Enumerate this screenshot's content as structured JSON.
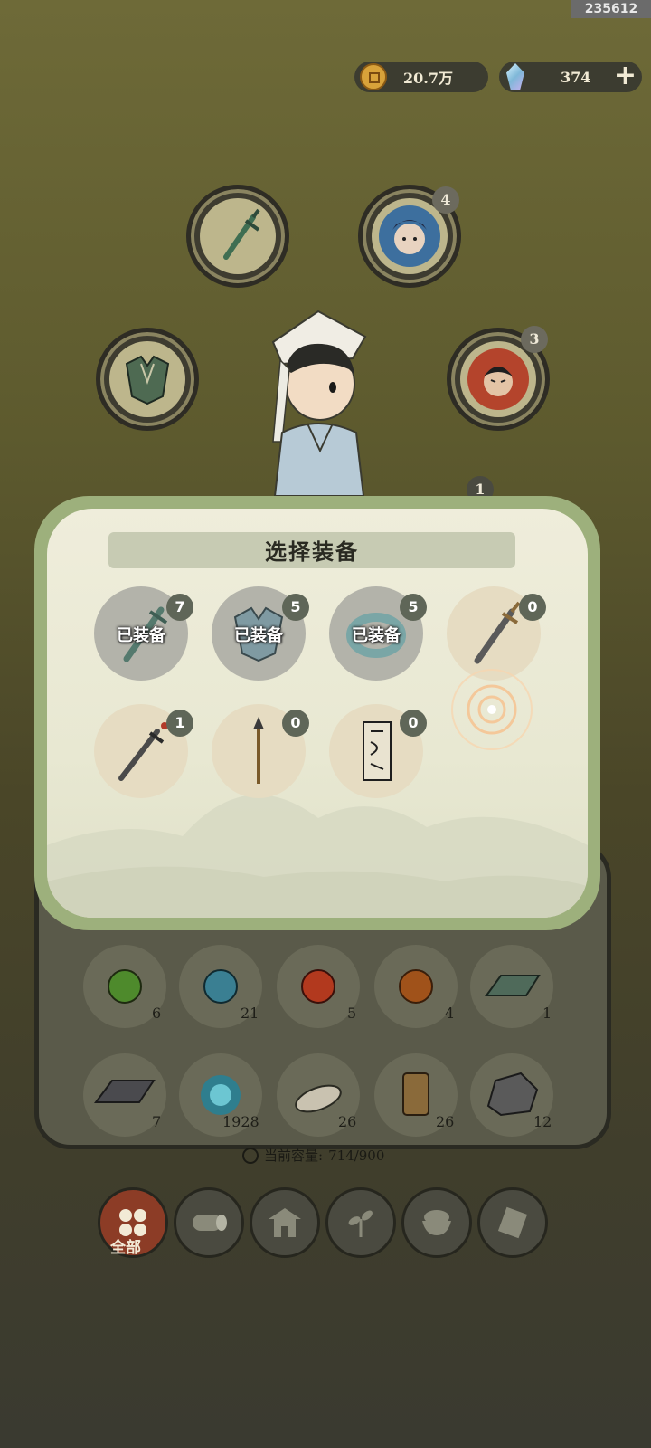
{
  "corner_id": "235612",
  "currency": {
    "coins": "20.7万",
    "gems": "374",
    "add_symbol": "+"
  },
  "equip_slots": [
    {
      "name": "weapon",
      "badge": ""
    },
    {
      "name": "companion-blue",
      "badge": "4"
    },
    {
      "name": "armor",
      "badge": ""
    },
    {
      "name": "companion-red",
      "badge": "3"
    },
    {
      "name": "partially-hidden-slot",
      "badge": "1"
    }
  ],
  "modal": {
    "title": "选择装备",
    "items": [
      {
        "name": "jade-sword",
        "count": "7",
        "equipped": true,
        "equipped_label": "已装备"
      },
      {
        "name": "leaf-armor",
        "count": "5",
        "equipped": true,
        "equipped_label": "已装备"
      },
      {
        "name": "jade-bracelet",
        "count": "5",
        "equipped": true,
        "equipped_label": "已装备"
      },
      {
        "name": "iron-sword",
        "count": "0",
        "equipped": false,
        "equipped_label": ""
      },
      {
        "name": "steel-sword",
        "count": "1",
        "equipped": false,
        "equipped_label": ""
      },
      {
        "name": "spear",
        "count": "0",
        "equipped": false,
        "equipped_label": ""
      },
      {
        "name": "talisman-scroll",
        "count": "0",
        "equipped": false,
        "equipped_label": ""
      }
    ]
  },
  "materials": [
    {
      "name": "green-orb",
      "count": "6",
      "color": "#4e8a2c"
    },
    {
      "name": "blue-orb",
      "count": "21",
      "color": "#3a7f92"
    },
    {
      "name": "red-orb",
      "count": "5",
      "color": "#b2391e"
    },
    {
      "name": "amber-orb",
      "count": "4",
      "color": "#a0521a"
    },
    {
      "name": "green-ingot",
      "count": "1",
      "color": "#4f6a5a"
    },
    {
      "name": "iron-ingot",
      "count": "7",
      "color": "#4a4a4e"
    },
    {
      "name": "spirit-flame",
      "count": "1928",
      "color": "#2f7e8e"
    },
    {
      "name": "bone",
      "count": "26",
      "color": "#c9c2b0"
    },
    {
      "name": "lantern-token",
      "count": "26",
      "color": "#8a6a3a"
    },
    {
      "name": "ore",
      "count": "12",
      "color": "#5a5a5a"
    }
  ],
  "capacity": {
    "label": "当前容量:",
    "value": "714/900"
  },
  "tabs": [
    {
      "name": "all",
      "label": "全部",
      "active": true
    },
    {
      "name": "wood",
      "label": "",
      "active": false
    },
    {
      "name": "building",
      "label": "",
      "active": false
    },
    {
      "name": "herb",
      "label": "",
      "active": false
    },
    {
      "name": "food",
      "label": "",
      "active": false
    },
    {
      "name": "scroll",
      "label": "",
      "active": false
    }
  ]
}
